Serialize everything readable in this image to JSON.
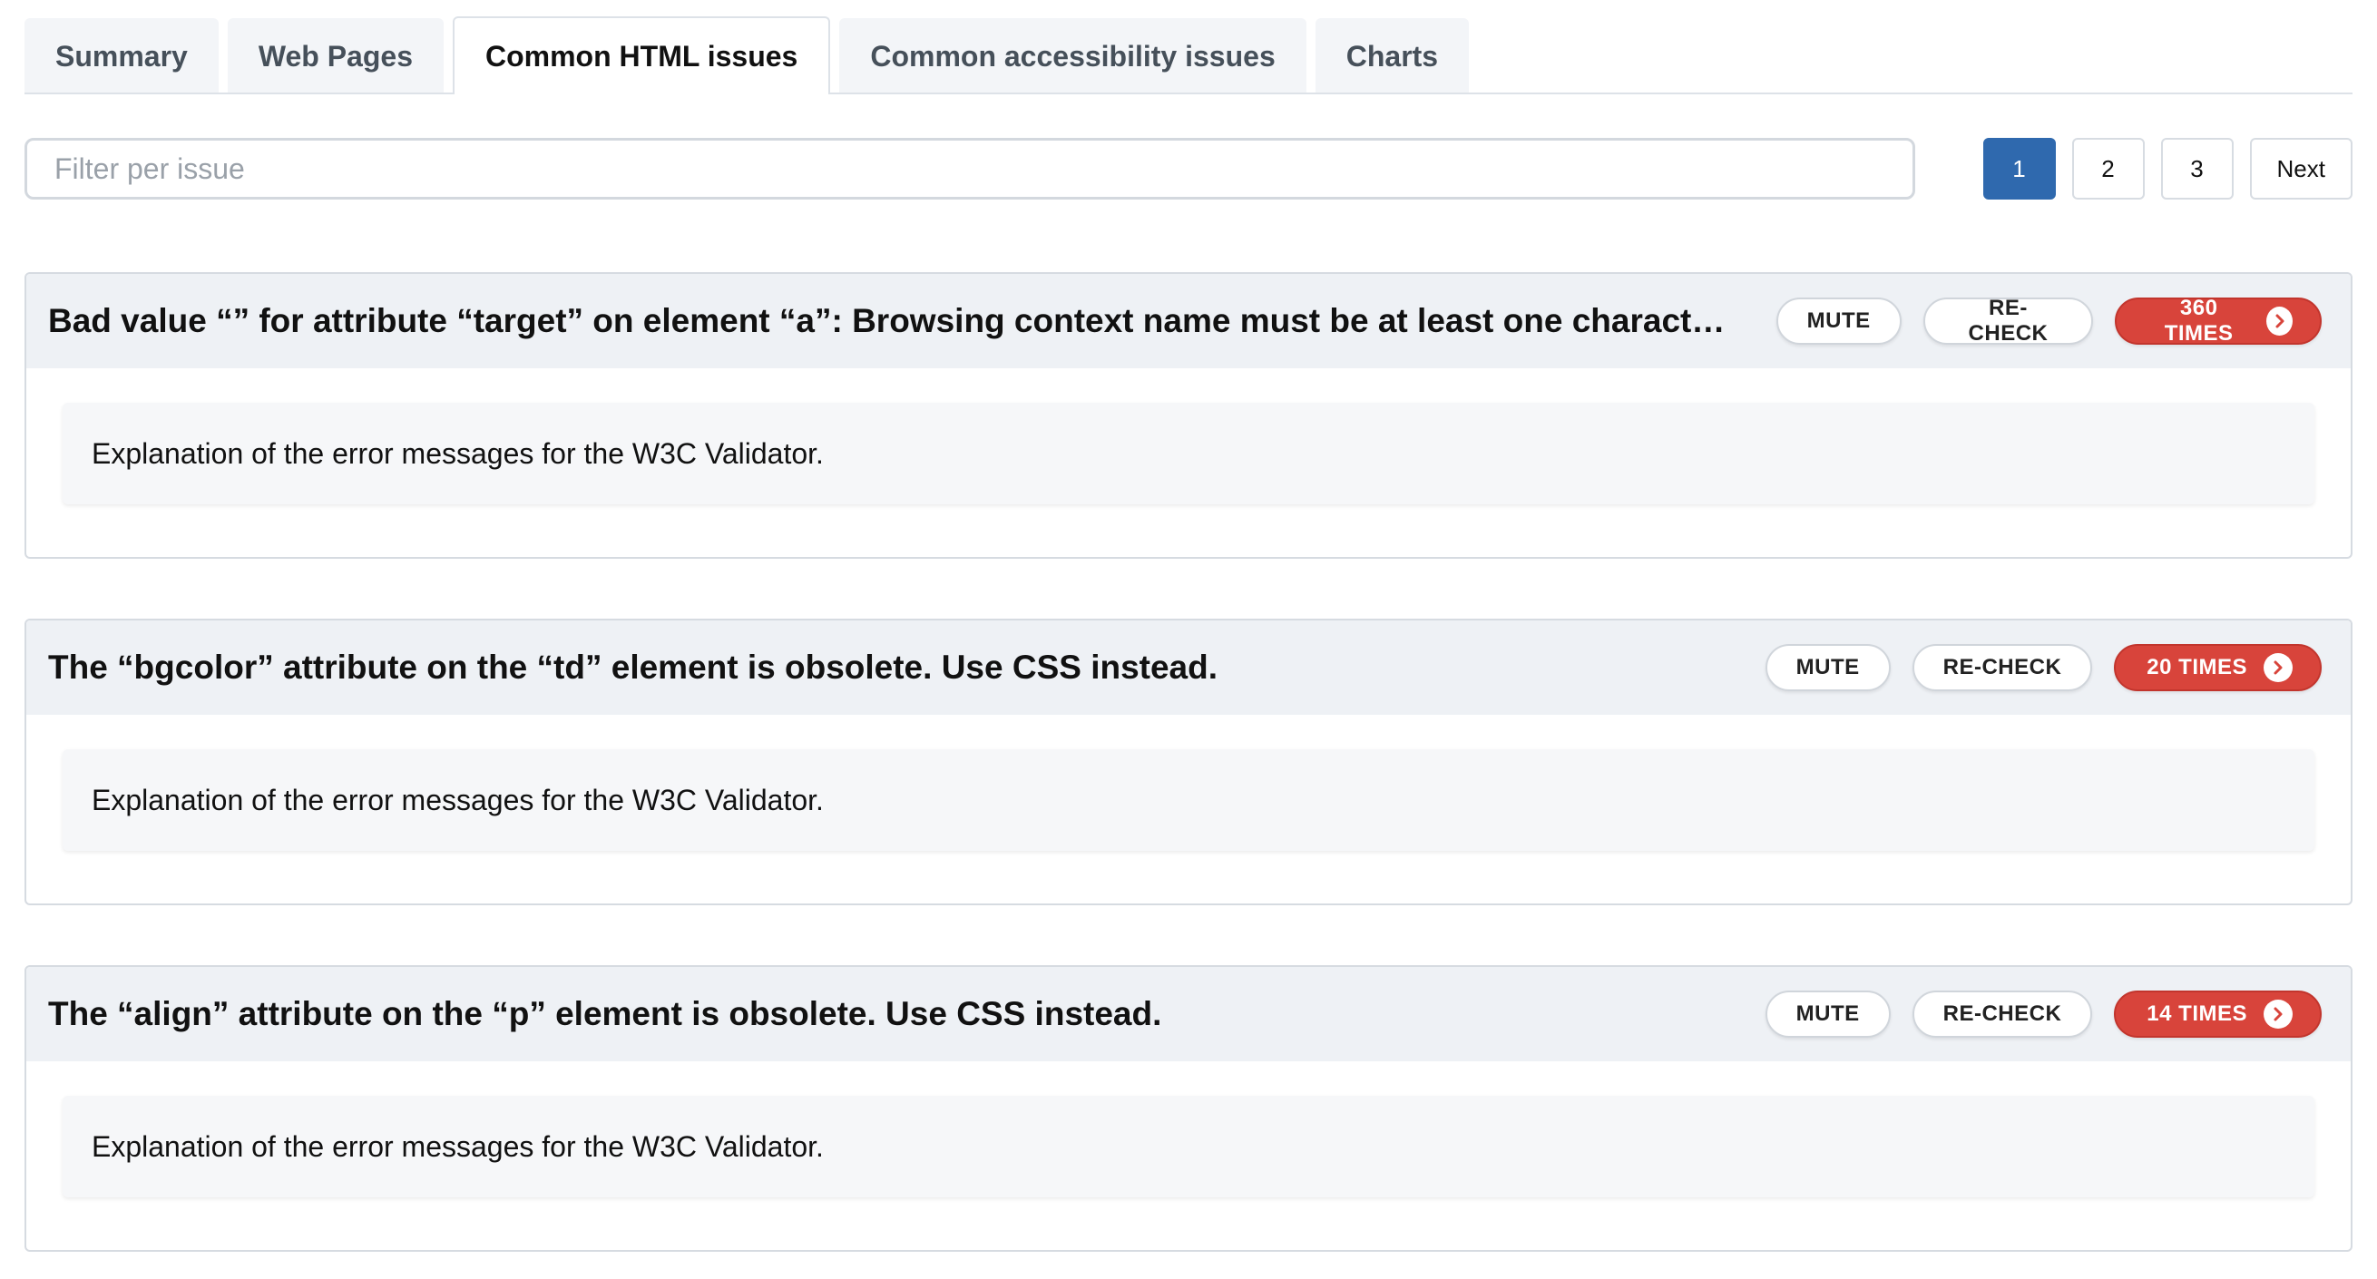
{
  "tabs": [
    {
      "label": "Summary",
      "active": false
    },
    {
      "label": "Web Pages",
      "active": false
    },
    {
      "label": "Common HTML issues",
      "active": true
    },
    {
      "label": "Common accessibility issues",
      "active": false
    },
    {
      "label": "Charts",
      "active": false
    }
  ],
  "filter": {
    "placeholder": "Filter per issue",
    "value": ""
  },
  "pagination": {
    "pages": [
      "1",
      "2",
      "3"
    ],
    "current": "1",
    "next_label": "Next"
  },
  "issue_actions": {
    "mute_label": "MUTE",
    "recheck_label": "RE-CHECK"
  },
  "issues": [
    {
      "title": "Bad value “” for attribute “target” on element “a”: Browsing context name must be at least one character long.",
      "count_label": "360 TIMES",
      "explanation": "Explanation of the error messages for the W3C Validator."
    },
    {
      "title": "The “bgcolor” attribute on the “td” element is obsolete. Use CSS instead.",
      "count_label": "20 TIMES",
      "explanation": "Explanation of the error messages for the W3C Validator."
    },
    {
      "title": "The “align” attribute on the “p” element is obsolete. Use CSS instead.",
      "count_label": "14 TIMES",
      "explanation": "Explanation of the error messages for the W3C Validator."
    }
  ],
  "icons": {
    "count_chevron": "chevron-right-circle-icon"
  },
  "colors": {
    "accent_blue": "#2f69ae",
    "count_red": "#d8443b",
    "header_bg": "#eef1f5"
  }
}
